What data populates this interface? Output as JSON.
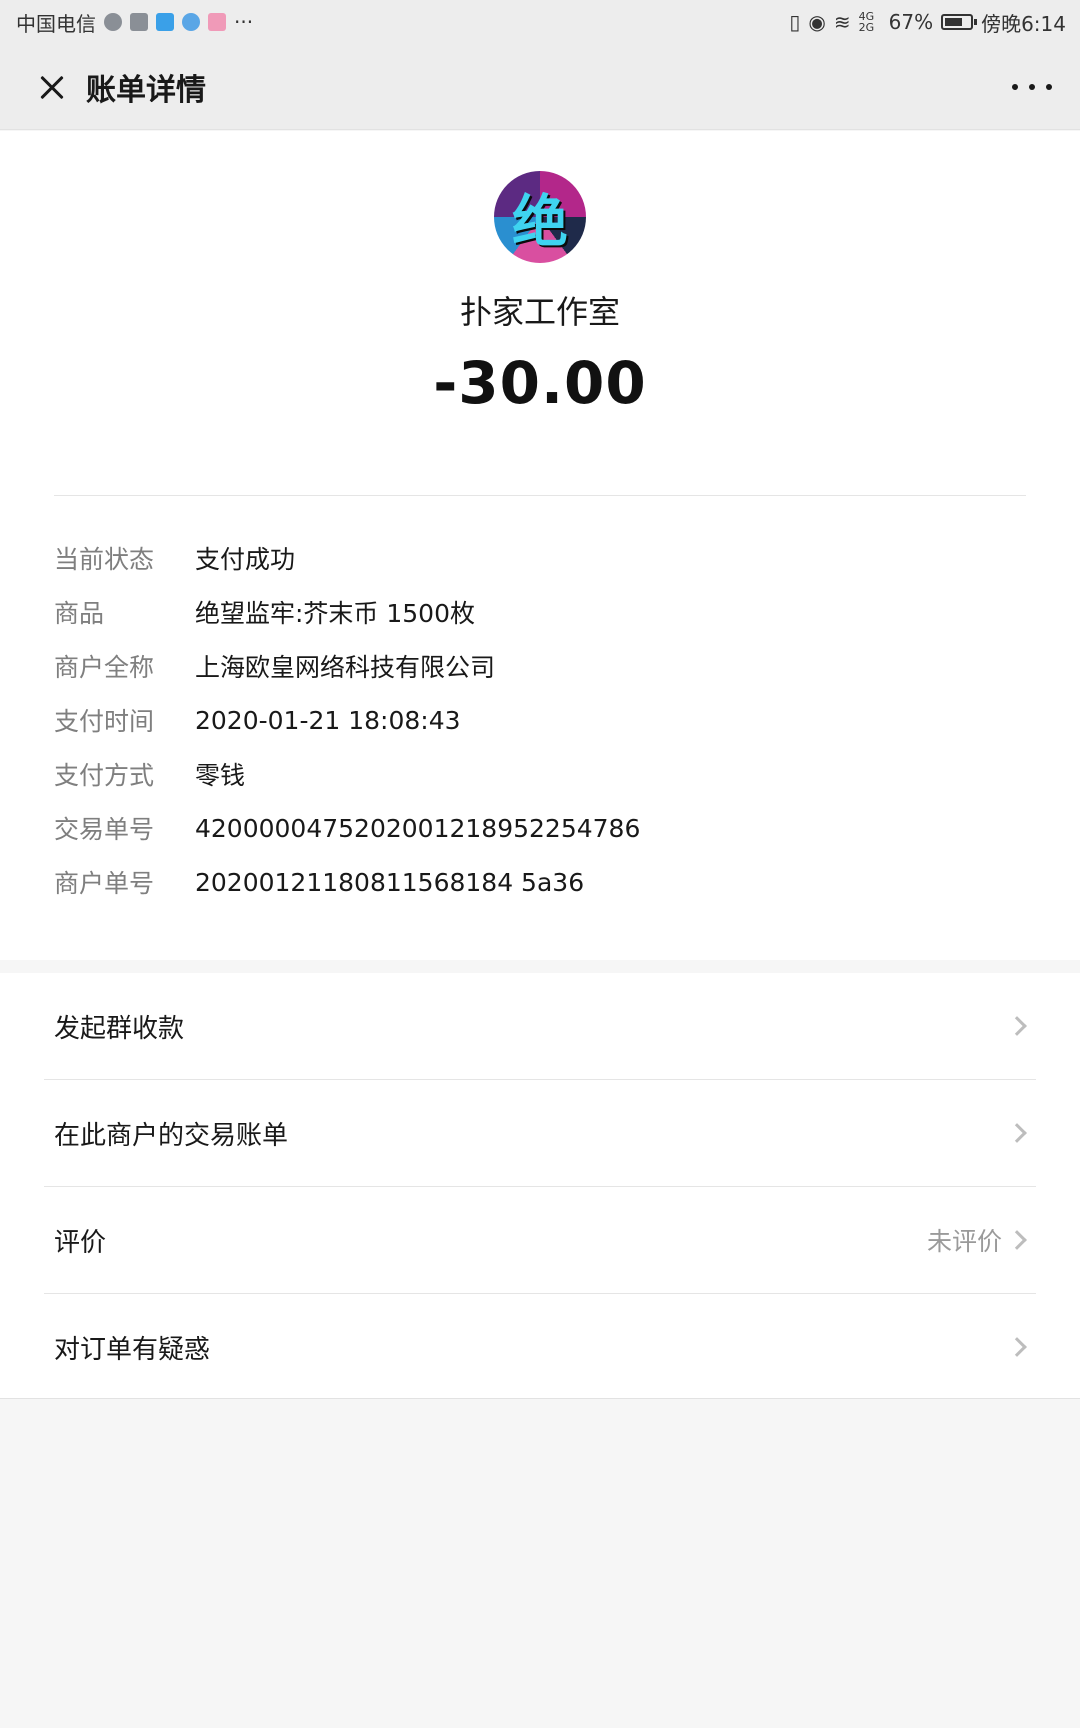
{
  "status_bar": {
    "carrier": "中国电信",
    "more_indicator": "···",
    "network": "4G 2G",
    "battery": "67%",
    "time": "傍晚6:14"
  },
  "nav": {
    "title": "账单详情"
  },
  "header": {
    "merchant_name": "扑家工作室",
    "amount": "-30.00",
    "avatar_glyph": "绝"
  },
  "details": [
    {
      "label": "当前状态",
      "value": "支付成功"
    },
    {
      "label": "商品",
      "value": "绝望监牢:芥末币 1500枚"
    },
    {
      "label": "商户全称",
      "value": "上海欧皇网络科技有限公司"
    },
    {
      "label": "支付时间",
      "value": "2020-01-21 18:08:43"
    },
    {
      "label": "支付方式",
      "value": "零钱"
    },
    {
      "label": "交易单号",
      "value": "4200000475202001218952254786"
    },
    {
      "label": "商户单号",
      "value": "20200121180811568184 5a36"
    }
  ],
  "actions": [
    {
      "label": "发起群收款",
      "value": ""
    },
    {
      "label": "在此商户的交易账单",
      "value": ""
    },
    {
      "label": "评价",
      "value": "未评价"
    },
    {
      "label": "对订单有疑惑",
      "value": ""
    }
  ]
}
